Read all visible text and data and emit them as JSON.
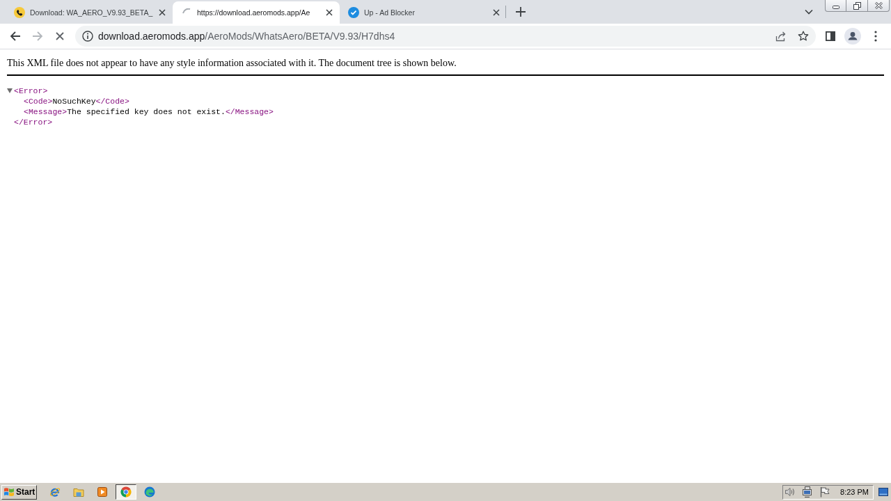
{
  "browser": {
    "tabs": [
      {
        "kind": "phone",
        "title": "Download: WA_AERO_V9.93_BETA_",
        "selected": false
      },
      {
        "kind": "loading",
        "title": "https://download.aeromods.app/Ae",
        "selected": true
      },
      {
        "kind": "check",
        "title": "Up - Ad Blocker",
        "selected": false
      }
    ]
  },
  "toolbar": {
    "nav": [
      {
        "kind": "back",
        "disabled": false
      },
      {
        "kind": "forward",
        "disabled": true
      }
    ],
    "loading": true,
    "url_host": "download.aeromods.app",
    "url_path": "/AeroMods/WhatsAero/BETA/V9.93/H7dhs4"
  },
  "page": {
    "notice": "This XML file does not appear to have any style information associated with it. The document tree is shown below.",
    "xml_tree": {
      "open_tag": "<Error>",
      "expanded": true,
      "children": [
        {
          "open_tag": "<Code>",
          "text": "NoSuchKey",
          "close_tag": "</Code>"
        },
        {
          "open_tag": "<Message>",
          "text": "The specified key does not exist.",
          "close_tag": "</Message>"
        }
      ],
      "close_tag": "</Error>"
    }
  },
  "taskbar": {
    "start": "Start",
    "apps": [
      {
        "kind": "ie",
        "selected": false
      },
      {
        "kind": "explorer",
        "selected": false
      },
      {
        "kind": "media",
        "selected": false
      },
      {
        "kind": "chrome",
        "selected": true
      },
      {
        "kind": "edge",
        "selected": false
      }
    ],
    "tray": [
      {
        "kind": "volume"
      },
      {
        "kind": "network"
      },
      {
        "kind": "flag"
      }
    ],
    "clock": "8:23 PM"
  }
}
